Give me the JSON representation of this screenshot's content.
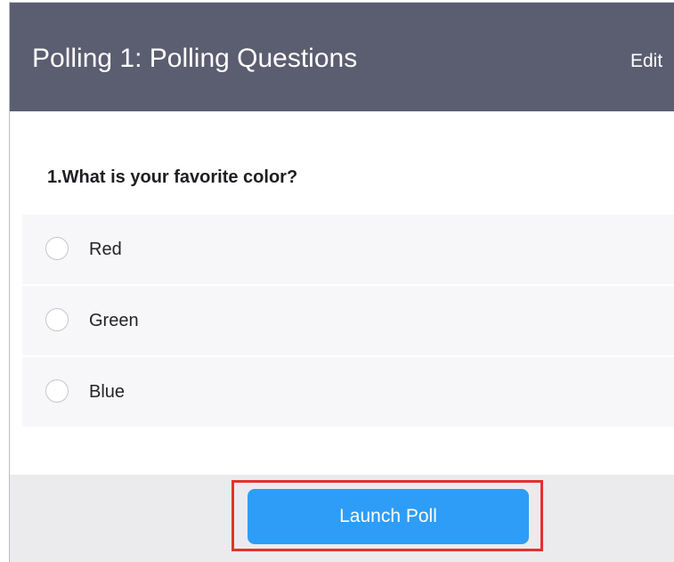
{
  "header": {
    "title": "Polling 1: Polling Questions",
    "edit_label": "Edit"
  },
  "question": {
    "text": "1.What is your favorite color?",
    "options": [
      {
        "label": "Red",
        "selected": false
      },
      {
        "label": "Green",
        "selected": false
      },
      {
        "label": "Blue",
        "selected": false
      }
    ]
  },
  "footer": {
    "launch_label": "Launch Poll",
    "highlight_color": "#e3322b",
    "button_color": "#2d9df7"
  },
  "theme": {
    "header_bg": "#5b5d70",
    "option_bg": "#f7f7fa",
    "footer_bg": "#ebebee"
  }
}
